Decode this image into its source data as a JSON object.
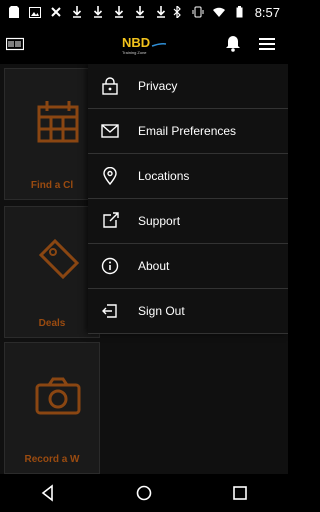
{
  "status_bar": {
    "time": "8:57",
    "left_icons": [
      "sd-card-icon",
      "image-icon",
      "close-icon",
      "download-icon",
      "download-icon",
      "download-icon",
      "download-icon",
      "download-icon"
    ],
    "right_icons": [
      "bluetooth-icon",
      "vibrate-icon",
      "wifi-icon",
      "battery-icon"
    ]
  },
  "app_bar": {
    "logo_text": "NBD",
    "logo_subtext": "Training Zone"
  },
  "background_tiles": [
    {
      "label": "Find a Cl"
    },
    {
      "label": "Deals"
    },
    {
      "label": "Record a W"
    }
  ],
  "drawer": {
    "items": [
      {
        "label": "Privacy",
        "icon": "lock-icon"
      },
      {
        "label": "Email Preferences",
        "icon": "envelope-icon"
      },
      {
        "label": "Locations",
        "icon": "location-pin-icon"
      },
      {
        "label": "Support",
        "icon": "external-link-icon"
      },
      {
        "label": "About",
        "icon": "info-icon"
      },
      {
        "label": "Sign Out",
        "icon": "sign-out-icon"
      }
    ]
  },
  "colors": {
    "accent_orange": "#c75c11",
    "logo_yellow": "#f2c31c",
    "logo_blue": "#2f8fd6"
  }
}
